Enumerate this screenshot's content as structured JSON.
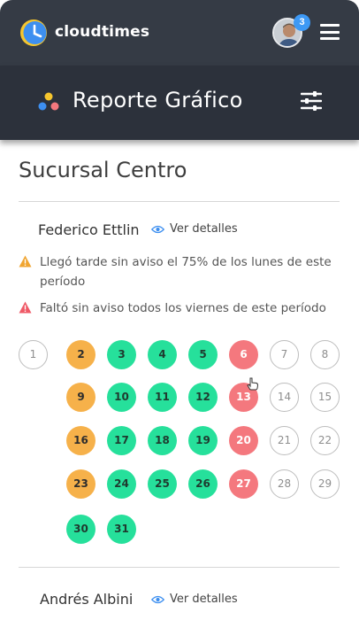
{
  "app": {
    "name": "cloudtimes"
  },
  "header": {
    "notification_count": "3"
  },
  "subheader": {
    "title": "Reporte Gráfico"
  },
  "branch": {
    "title": "Sucursal Centro"
  },
  "employees": [
    {
      "name": "Federico Ettlin",
      "details_label": "Ver detalles",
      "alerts": [
        {
          "text": "Llegó tarde sin aviso el 75% de los lunes de este período",
          "color": "#f0a531"
        },
        {
          "text": "Faltó sin aviso todos los viernes de este período",
          "color": "#ef5a67"
        }
      ],
      "days": [
        {
          "d": "1",
          "s": "none"
        },
        {
          "d": "2",
          "s": "late"
        },
        {
          "d": "3",
          "s": "ok"
        },
        {
          "d": "4",
          "s": "ok"
        },
        {
          "d": "5",
          "s": "ok"
        },
        {
          "d": "6",
          "s": "absent"
        },
        {
          "d": "7",
          "s": "none"
        },
        {
          "d": "8",
          "s": "none"
        },
        {
          "d": "9",
          "s": "late"
        },
        {
          "d": "10",
          "s": "ok"
        },
        {
          "d": "11",
          "s": "ok"
        },
        {
          "d": "12",
          "s": "ok"
        },
        {
          "d": "13",
          "s": "absent"
        },
        {
          "d": "14",
          "s": "none"
        },
        {
          "d": "15",
          "s": "none"
        },
        {
          "d": "16",
          "s": "late"
        },
        {
          "d": "17",
          "s": "ok"
        },
        {
          "d": "18",
          "s": "ok"
        },
        {
          "d": "19",
          "s": "ok"
        },
        {
          "d": "20",
          "s": "absent"
        },
        {
          "d": "21",
          "s": "none"
        },
        {
          "d": "22",
          "s": "none"
        },
        {
          "d": "23",
          "s": "late"
        },
        {
          "d": "24",
          "s": "ok"
        },
        {
          "d": "25",
          "s": "ok"
        },
        {
          "d": "26",
          "s": "ok"
        },
        {
          "d": "27",
          "s": "absent"
        },
        {
          "d": "28",
          "s": "none"
        },
        {
          "d": "29",
          "s": "none"
        },
        {
          "d": "30",
          "s": "ok"
        },
        {
          "d": "31",
          "s": "ok"
        }
      ]
    },
    {
      "name": "Andrés Albini",
      "details_label": "Ver detalles"
    }
  ],
  "colors": {
    "late": "#f6b14a",
    "ok": "#26e09b",
    "absent": "#f4787e",
    "topbar": "#353b45",
    "subheader": "#2c313b"
  },
  "icons": [
    "clock-logo-icon",
    "avatar",
    "hamburger-menu-icon",
    "report-dots-icon",
    "filter-sliders-icon",
    "eye-icon",
    "warning-icon",
    "pointer-cursor-icon"
  ]
}
